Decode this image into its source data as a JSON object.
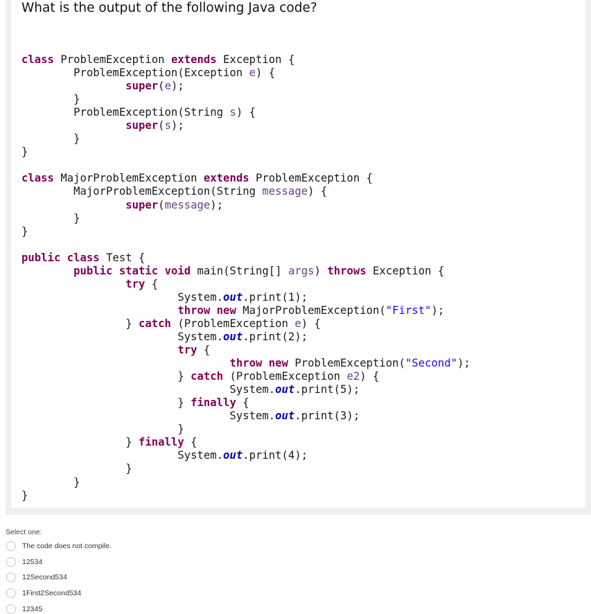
{
  "question": {
    "text": "What is the output of the following Java code?"
  },
  "code": {
    "lines": [
      [
        {
          "t": "class",
          "c": "k"
        },
        {
          "t": " ProblemException "
        },
        {
          "t": "extends",
          "c": "k"
        },
        {
          "t": " Exception {"
        }
      ],
      [
        {
          "t": "        ProblemException(Exception "
        },
        {
          "t": "e",
          "c": "p"
        },
        {
          "t": ") {"
        }
      ],
      [
        {
          "t": "                "
        },
        {
          "t": "super",
          "c": "k"
        },
        {
          "t": "("
        },
        {
          "t": "e",
          "c": "p"
        },
        {
          "t": ");"
        }
      ],
      [
        {
          "t": "        }"
        }
      ],
      [
        {
          "t": "        ProblemException(String "
        },
        {
          "t": "s",
          "c": "p"
        },
        {
          "t": ") {"
        }
      ],
      [
        {
          "t": "                "
        },
        {
          "t": "super",
          "c": "k"
        },
        {
          "t": "("
        },
        {
          "t": "s",
          "c": "p"
        },
        {
          "t": ");"
        }
      ],
      [
        {
          "t": "        }"
        }
      ],
      [
        {
          "t": "}"
        }
      ],
      [],
      [
        {
          "t": "class",
          "c": "k"
        },
        {
          "t": " MajorProblemException "
        },
        {
          "t": "extends",
          "c": "k"
        },
        {
          "t": " ProblemException {"
        }
      ],
      [
        {
          "t": "        MajorProblemException(String "
        },
        {
          "t": "message",
          "c": "p"
        },
        {
          "t": ") {"
        }
      ],
      [
        {
          "t": "                "
        },
        {
          "t": "super",
          "c": "k"
        },
        {
          "t": "("
        },
        {
          "t": "message",
          "c": "p"
        },
        {
          "t": ");"
        }
      ],
      [
        {
          "t": "        }"
        }
      ],
      [
        {
          "t": "}"
        }
      ],
      [],
      [
        {
          "t": "public",
          "c": "k"
        },
        {
          "t": " "
        },
        {
          "t": "class",
          "c": "k"
        },
        {
          "t": " Test {"
        }
      ],
      [
        {
          "t": "        "
        },
        {
          "t": "public",
          "c": "k"
        },
        {
          "t": " "
        },
        {
          "t": "static",
          "c": "k"
        },
        {
          "t": " "
        },
        {
          "t": "void",
          "c": "k"
        },
        {
          "t": " main(String[] "
        },
        {
          "t": "args",
          "c": "p"
        },
        {
          "t": ") "
        },
        {
          "t": "throws",
          "c": "k"
        },
        {
          "t": " Exception {"
        }
      ],
      [
        {
          "t": "                "
        },
        {
          "t": "try",
          "c": "k"
        },
        {
          "t": " {"
        }
      ],
      [
        {
          "t": "                        System."
        },
        {
          "t": "out",
          "c": "o"
        },
        {
          "t": ".print(1);"
        }
      ],
      [
        {
          "t": "                        "
        },
        {
          "t": "throw",
          "c": "k"
        },
        {
          "t": " "
        },
        {
          "t": "new",
          "c": "k"
        },
        {
          "t": " MajorProblemException("
        },
        {
          "t": "\"First\"",
          "c": "s"
        },
        {
          "t": ");"
        }
      ],
      [
        {
          "t": "                } "
        },
        {
          "t": "catch",
          "c": "k"
        },
        {
          "t": " (ProblemException "
        },
        {
          "t": "e",
          "c": "p"
        },
        {
          "t": ") {"
        }
      ],
      [
        {
          "t": "                        System."
        },
        {
          "t": "out",
          "c": "o"
        },
        {
          "t": ".print(2);"
        }
      ],
      [
        {
          "t": "                        "
        },
        {
          "t": "try",
          "c": "k"
        },
        {
          "t": " {"
        }
      ],
      [
        {
          "t": "                                "
        },
        {
          "t": "throw",
          "c": "k"
        },
        {
          "t": " "
        },
        {
          "t": "new",
          "c": "k"
        },
        {
          "t": " ProblemException("
        },
        {
          "t": "\"Second\"",
          "c": "s"
        },
        {
          "t": ");"
        }
      ],
      [
        {
          "t": "                        } "
        },
        {
          "t": "catch",
          "c": "k"
        },
        {
          "t": " (ProblemException "
        },
        {
          "t": "e2",
          "c": "p"
        },
        {
          "t": ") {"
        }
      ],
      [
        {
          "t": "                                System."
        },
        {
          "t": "out",
          "c": "o"
        },
        {
          "t": ".print(5);"
        }
      ],
      [
        {
          "t": "                        } "
        },
        {
          "t": "finally",
          "c": "k"
        },
        {
          "t": " {"
        }
      ],
      [
        {
          "t": "                                System."
        },
        {
          "t": "out",
          "c": "o"
        },
        {
          "t": ".print(3);"
        }
      ],
      [
        {
          "t": "                        }"
        }
      ],
      [
        {
          "t": "                } "
        },
        {
          "t": "finally",
          "c": "k"
        },
        {
          "t": " {"
        }
      ],
      [
        {
          "t": "                        System."
        },
        {
          "t": "out",
          "c": "o"
        },
        {
          "t": ".print(4);"
        }
      ],
      [
        {
          "t": "                }"
        }
      ],
      [
        {
          "t": "        }"
        }
      ],
      [
        {
          "t": "}"
        }
      ]
    ]
  },
  "answer": {
    "prompt": "Select one:",
    "options": [
      {
        "label": "The code does not compile.",
        "selected": false
      },
      {
        "label": "12534",
        "selected": false
      },
      {
        "label": "12Second534",
        "selected": false
      },
      {
        "label": "1First2Second534",
        "selected": false
      },
      {
        "label": "12345",
        "selected": false
      }
    ]
  }
}
